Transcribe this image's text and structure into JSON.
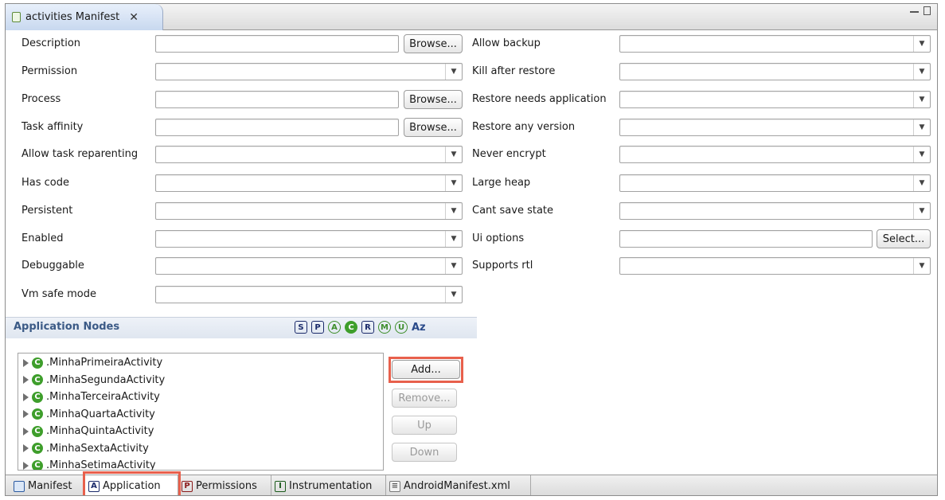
{
  "editor": {
    "tab_title": "activities Manifest",
    "close_glyph": "✕"
  },
  "left_fields": [
    {
      "label": "Description",
      "kind": "text",
      "button": "Browse..."
    },
    {
      "label": "Permission",
      "kind": "combo"
    },
    {
      "label": "Process",
      "kind": "text",
      "button": "Browse..."
    },
    {
      "label": "Task affinity",
      "kind": "text",
      "button": "Browse..."
    },
    {
      "label": "Allow task reparenting",
      "kind": "combo"
    },
    {
      "label": "Has code",
      "kind": "combo"
    },
    {
      "label": "Persistent",
      "kind": "combo"
    },
    {
      "label": "Enabled",
      "kind": "combo"
    },
    {
      "label": "Debuggable",
      "kind": "combo"
    },
    {
      "label": "Vm safe mode",
      "kind": "combo"
    }
  ],
  "right_fields": [
    {
      "label": "Allow backup",
      "kind": "combo"
    },
    {
      "label": "Kill after restore",
      "kind": "combo"
    },
    {
      "label": "Restore needs application",
      "kind": "combo"
    },
    {
      "label": "Restore any version",
      "kind": "combo"
    },
    {
      "label": "Never encrypt",
      "kind": "combo"
    },
    {
      "label": "Large heap",
      "kind": "combo"
    },
    {
      "label": "Cant save state",
      "kind": "combo"
    },
    {
      "label": "Ui options",
      "kind": "text",
      "button": "Select..."
    },
    {
      "label": "Supports rtl",
      "kind": "combo"
    }
  ],
  "application_nodes": {
    "title": "Application Nodes",
    "toolbar_icons": [
      {
        "glyph": "S",
        "icon": "service-icon"
      },
      {
        "glyph": "P",
        "icon": "provider-icon"
      },
      {
        "glyph": "A",
        "icon": "activity-alias-icon"
      },
      {
        "glyph": "C",
        "icon": "class-icon"
      },
      {
        "glyph": "R",
        "icon": "receiver-icon"
      },
      {
        "glyph": "M",
        "icon": "meta-data-icon"
      },
      {
        "glyph": "U",
        "icon": "uses-library-icon"
      },
      {
        "glyph": "Az",
        "icon": "sort-alpha-icon"
      }
    ],
    "items": [
      ".MinhaPrimeiraActivity",
      ".MinhaSegundaActivity",
      ".MinhaTerceiraActivity",
      ".MinhaQuartaActivity",
      ".MinhaQuintaActivity",
      ".MinhaSextaActivity",
      ".MinhaSetimaActivity"
    ],
    "buttons": {
      "add": "Add...",
      "remove": "Remove...",
      "up": "Up",
      "down": "Down"
    }
  },
  "bottom_tabs": [
    {
      "label": "Manifest",
      "icon": "manifest-icon",
      "glyph": ""
    },
    {
      "label": "Application",
      "icon": "application-icon",
      "glyph": "A",
      "active": true
    },
    {
      "label": "Permissions",
      "icon": "permissions-icon",
      "glyph": "P"
    },
    {
      "label": "Instrumentation",
      "icon": "instrumentation-icon",
      "glyph": "I"
    },
    {
      "label": "AndroidManifest.xml",
      "icon": "xml-file-icon",
      "glyph": "≡"
    }
  ],
  "colors": {
    "highlight": "#e8604c",
    "section_title": "#3b5a86",
    "node_green": "#3e9e2b"
  }
}
